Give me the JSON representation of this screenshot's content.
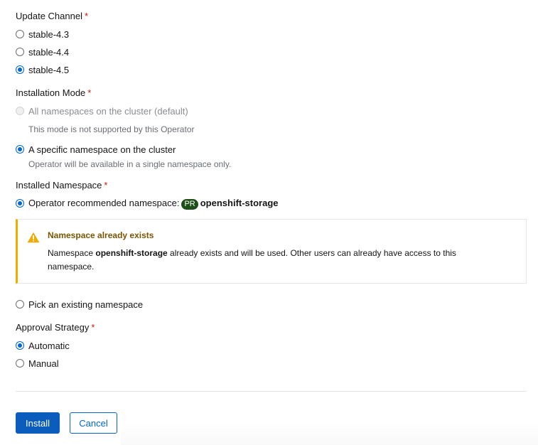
{
  "update_channel": {
    "label": "Update Channel",
    "required_mark": "*",
    "options": [
      {
        "label": "stable-4.3",
        "checked": false
      },
      {
        "label": "stable-4.4",
        "checked": false
      },
      {
        "label": "stable-4.5",
        "checked": true
      }
    ]
  },
  "installation_mode": {
    "label": "Installation Mode",
    "required_mark": "*",
    "options": [
      {
        "label": "All namespaces on the cluster (default)",
        "help": "This mode is not supported by this Operator",
        "checked": false,
        "disabled": true
      },
      {
        "label": "A specific namespace on the cluster",
        "help": "Operator will be available in a single namespace only.",
        "checked": true,
        "disabled": false
      }
    ]
  },
  "installed_namespace": {
    "label": "Installed Namespace",
    "required_mark": "*",
    "recommended_prefix": "Operator recommended namespace:",
    "badge": "PR",
    "namespace": "openshift-storage",
    "pick_existing_label": "Pick an existing namespace",
    "alert": {
      "title": "Namespace already exists",
      "body_prefix": "Namespace ",
      "body_namespace": "openshift-storage",
      "body_suffix": " already exists and will be used. Other users can already have access to this namespace."
    }
  },
  "approval_strategy": {
    "label": "Approval Strategy",
    "required_mark": "*",
    "options": [
      {
        "label": "Automatic",
        "checked": true
      },
      {
        "label": "Manual",
        "checked": false
      }
    ]
  },
  "actions": {
    "install_label": "Install",
    "cancel_label": "Cancel"
  },
  "colors": {
    "primary": "#0066cc",
    "warning": "#f0ab00",
    "required": "#c9190b",
    "badge": "#1e4f18"
  },
  "icons": {
    "alert": "warning-triangle-icon"
  }
}
